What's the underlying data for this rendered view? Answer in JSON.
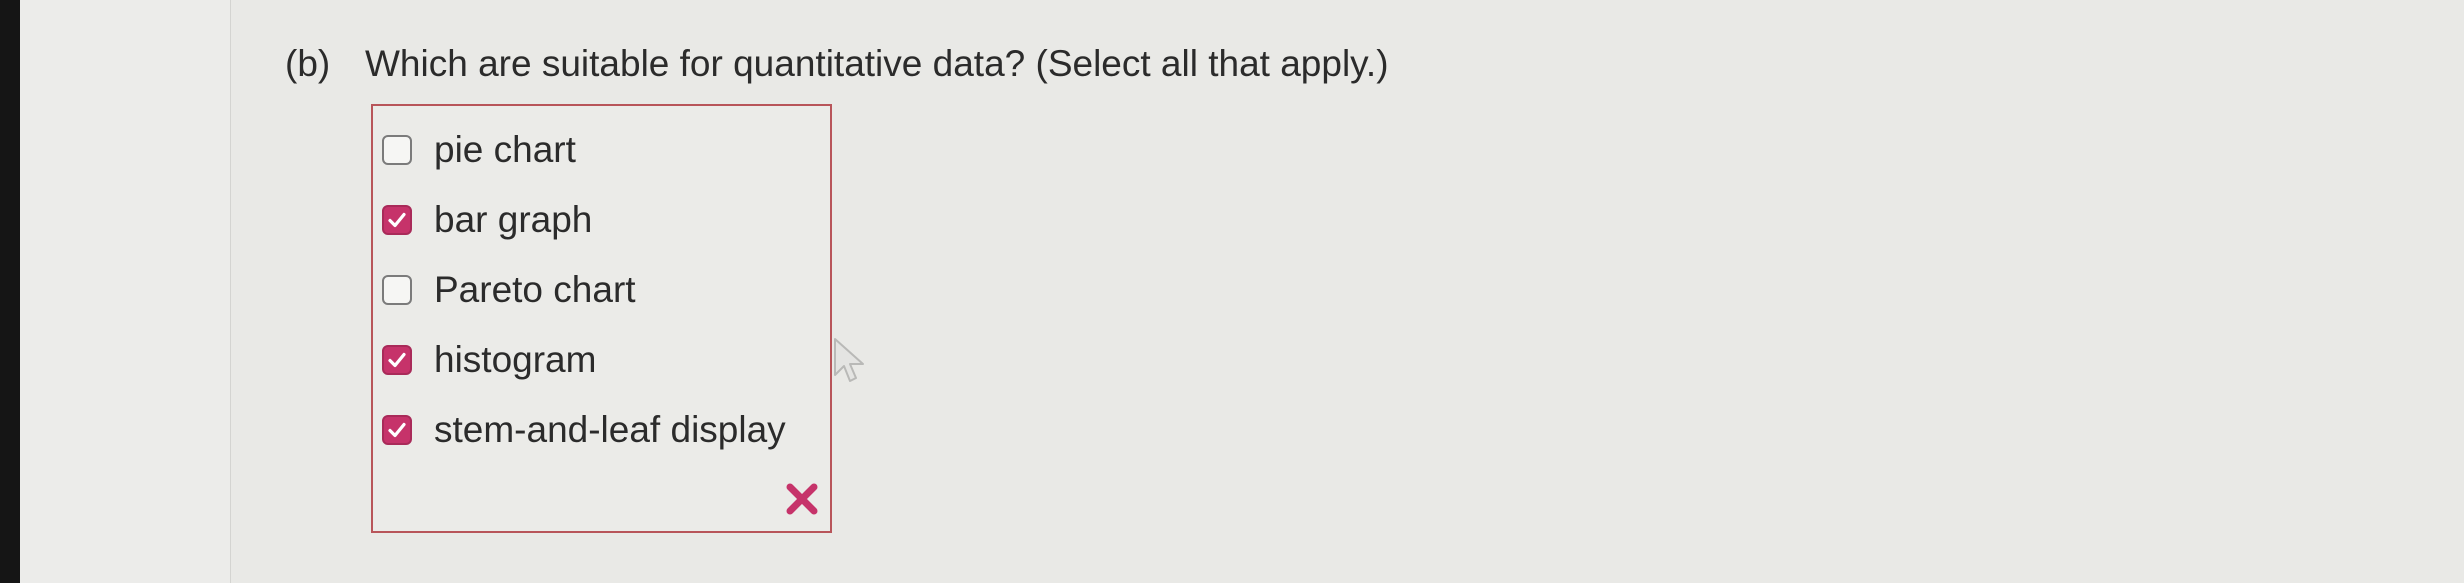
{
  "question": {
    "part_label": "(b)",
    "text": "Which are suitable for quantitative data? (Select all that apply.)"
  },
  "options": [
    {
      "label": "pie chart",
      "checked": false
    },
    {
      "label": "bar graph",
      "checked": true
    },
    {
      "label": "Pareto chart",
      "checked": false
    },
    {
      "label": "histogram",
      "checked": true
    },
    {
      "label": "stem-and-leaf display",
      "checked": true
    }
  ],
  "feedback": {
    "icon": "incorrect-x-icon",
    "color": "#c6336a"
  },
  "colors": {
    "checkbox_checked": "#c6336a",
    "answer_border": "#b8555a",
    "text": "#2b2b2b"
  }
}
